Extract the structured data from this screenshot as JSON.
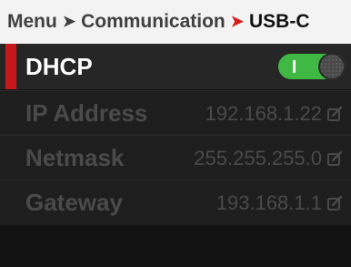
{
  "breadcrumb": {
    "items": [
      "Menu",
      "Communication",
      "USB-C"
    ]
  },
  "dhcp": {
    "label": "DHCP",
    "enabled": true
  },
  "fields": [
    {
      "label": "IP Address",
      "value": "192.168.1.22"
    },
    {
      "label": "Netmask",
      "value": "255.255.255.0"
    },
    {
      "label": "Gateway",
      "value": "193.168.1.1"
    }
  ],
  "colors": {
    "accent": "#c8171c",
    "toggle_on": "#3fb844",
    "header_bg": "#f3f3f3",
    "disabled_text": "#4a4a4a"
  },
  "icons": {
    "separator": "chevron-right-icon",
    "edit": "edit-icon"
  }
}
